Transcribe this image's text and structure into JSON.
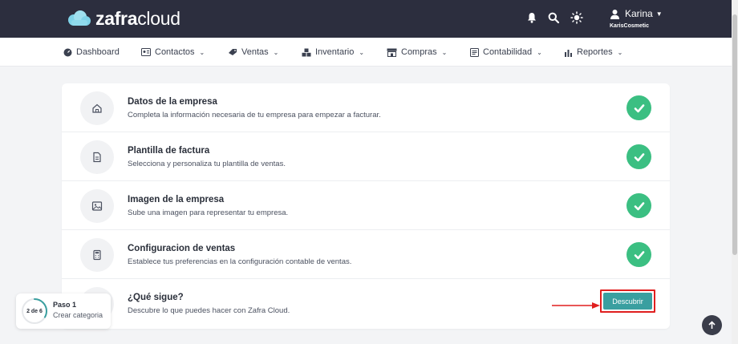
{
  "header": {
    "logo_text_bold": "zafra",
    "logo_text_thin": "cloud",
    "user_name": "Karina",
    "user_company": "KarisCosmetic",
    "icons": [
      "bell-icon",
      "search-icon",
      "sun-icon",
      "user-icon"
    ]
  },
  "nav": {
    "items": [
      {
        "label": "Dashboard",
        "icon": "dashboard-icon",
        "dropdown": false
      },
      {
        "label": "Contactos",
        "icon": "contacts-card-icon",
        "dropdown": true
      },
      {
        "label": "Ventas",
        "icon": "tag-icon",
        "dropdown": true
      },
      {
        "label": "Inventario",
        "icon": "boxes-icon",
        "dropdown": true
      },
      {
        "label": "Compras",
        "icon": "store-icon",
        "dropdown": true
      },
      {
        "label": "Contabilidad",
        "icon": "ledger-icon",
        "dropdown": true
      },
      {
        "label": "Reportes",
        "icon": "bar-chart-icon",
        "dropdown": true
      }
    ]
  },
  "steps": [
    {
      "title": "Datos de la empresa",
      "desc": "Completa la información necesaria de tu empresa para empezar a facturar.",
      "icon": "home-icon",
      "status": "done"
    },
    {
      "title": "Plantilla de factura",
      "desc": "Selecciona y personaliza tu plantilla de ventas.",
      "icon": "document-icon",
      "status": "done"
    },
    {
      "title": "Imagen de la empresa",
      "desc": "Sube una imagen para representar tu empresa.",
      "icon": "image-icon",
      "status": "done"
    },
    {
      "title": "Configuracion de ventas",
      "desc": "Establece tus preferencias en la configuración contable de ventas.",
      "icon": "calculator-icon",
      "status": "done"
    },
    {
      "title": "¿Qué sigue?",
      "desc": "Descubre lo que puedes hacer con Zafra Cloud.",
      "icon": "sparkle-icon",
      "status": "action",
      "button_label": "Descubrir"
    }
  ],
  "paso_widget": {
    "progress_text": "2 de 6",
    "progress_fraction": 0.333,
    "title": "Paso 1",
    "subtitle": "Crear categoria"
  },
  "colors": {
    "header_bg": "#2c2e3e",
    "success": "#3bbf82",
    "primary_button": "#3a9fa0",
    "highlight": "#e01f1f"
  }
}
